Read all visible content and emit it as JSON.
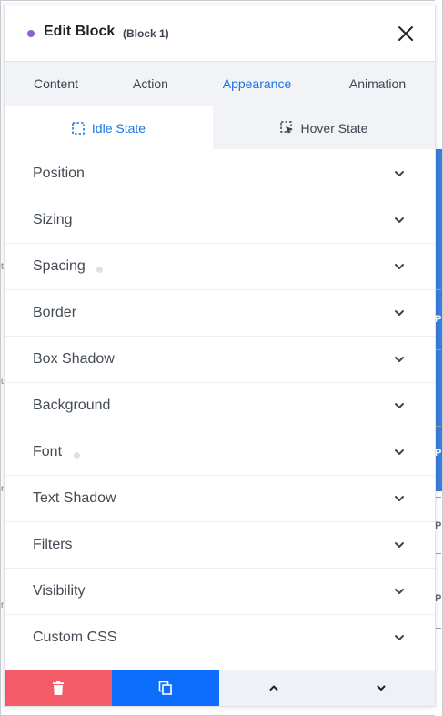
{
  "header": {
    "title": "Edit Block",
    "subtitle": "(Block 1)"
  },
  "tabs": [
    {
      "label": "Content"
    },
    {
      "label": "Action"
    },
    {
      "label": "Appearance"
    },
    {
      "label": "Animation"
    }
  ],
  "active_tab": "Appearance",
  "states": {
    "idle": "Idle State",
    "hover": "Hover State",
    "active": "idle"
  },
  "sections": [
    {
      "label": "Position",
      "modified": false
    },
    {
      "label": "Sizing",
      "modified": false
    },
    {
      "label": "Spacing",
      "modified": true
    },
    {
      "label": "Border",
      "modified": false
    },
    {
      "label": "Box Shadow",
      "modified": false
    },
    {
      "label": "Background",
      "modified": false
    },
    {
      "label": "Font",
      "modified": true
    },
    {
      "label": "Text Shadow",
      "modified": false
    },
    {
      "label": "Filters",
      "modified": false
    },
    {
      "label": "Visibility",
      "modified": false
    },
    {
      "label": "Custom CSS",
      "modified": false
    }
  ],
  "icons": {
    "close": "close-icon",
    "idle": "dashed-square-icon",
    "hover": "dashed-square-cursor-icon",
    "expand": "chevron-down-icon",
    "delete": "trash-icon",
    "duplicate": "copy-icon",
    "move_up": "chevron-up-icon",
    "move_down": "chevron-down-icon"
  },
  "colors": {
    "accent": "#1a73e8",
    "status_dot": "#8a63d2",
    "delete_bg": "#f45b69",
    "duplicate_bg": "#0d6efd",
    "move_bg": "#eef1f5"
  }
}
